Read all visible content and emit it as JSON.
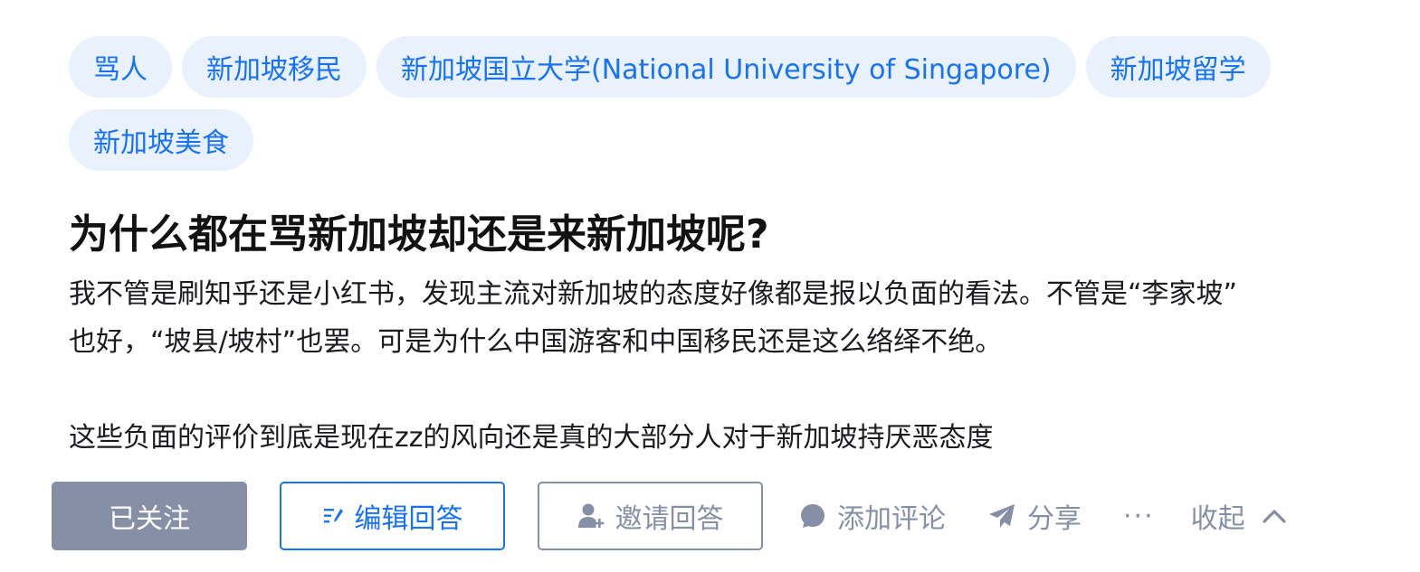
{
  "tags": [
    {
      "label": "骂人"
    },
    {
      "label": "新加坡移民"
    },
    {
      "label": "新加坡国立大学(National University of Singapore)"
    },
    {
      "label": "新加坡留学"
    },
    {
      "label": "新加坡美食"
    }
  ],
  "question": {
    "title": "为什么都在骂新加坡却还是来新加坡呢?",
    "detail_p1_line1": "我不管是刷知乎还是小红书，发现主流对新加坡的态度好像都是报以负面的看法。不管是“李家坡”",
    "detail_p1_line2": "也好，“坡县/坡村”也罢。可是为什么中国游客和中国移民还是这么络绎不绝。",
    "detail_p2": "这些负面的评价到底是现在zz的风向还是真的大部分人对于新加坡持厌恶态度"
  },
  "actions": {
    "follow_label": "已关注",
    "write_label": "编辑回答",
    "invite_label": "邀请回答",
    "comment_label": "添加评论",
    "share_label": "分享",
    "more_label": "···",
    "collapse_label": "收起"
  },
  "colors": {
    "brand_blue": "#1772f6",
    "tag_bg": "#e8f1fc",
    "muted_gray": "#8590a6",
    "title_text": "#121212"
  },
  "icons": {
    "write": "edit-icon",
    "invite": "invite-user-icon",
    "comment": "comment-bubble-icon",
    "share": "paper-plane-icon",
    "collapse": "chevron-up-icon"
  }
}
